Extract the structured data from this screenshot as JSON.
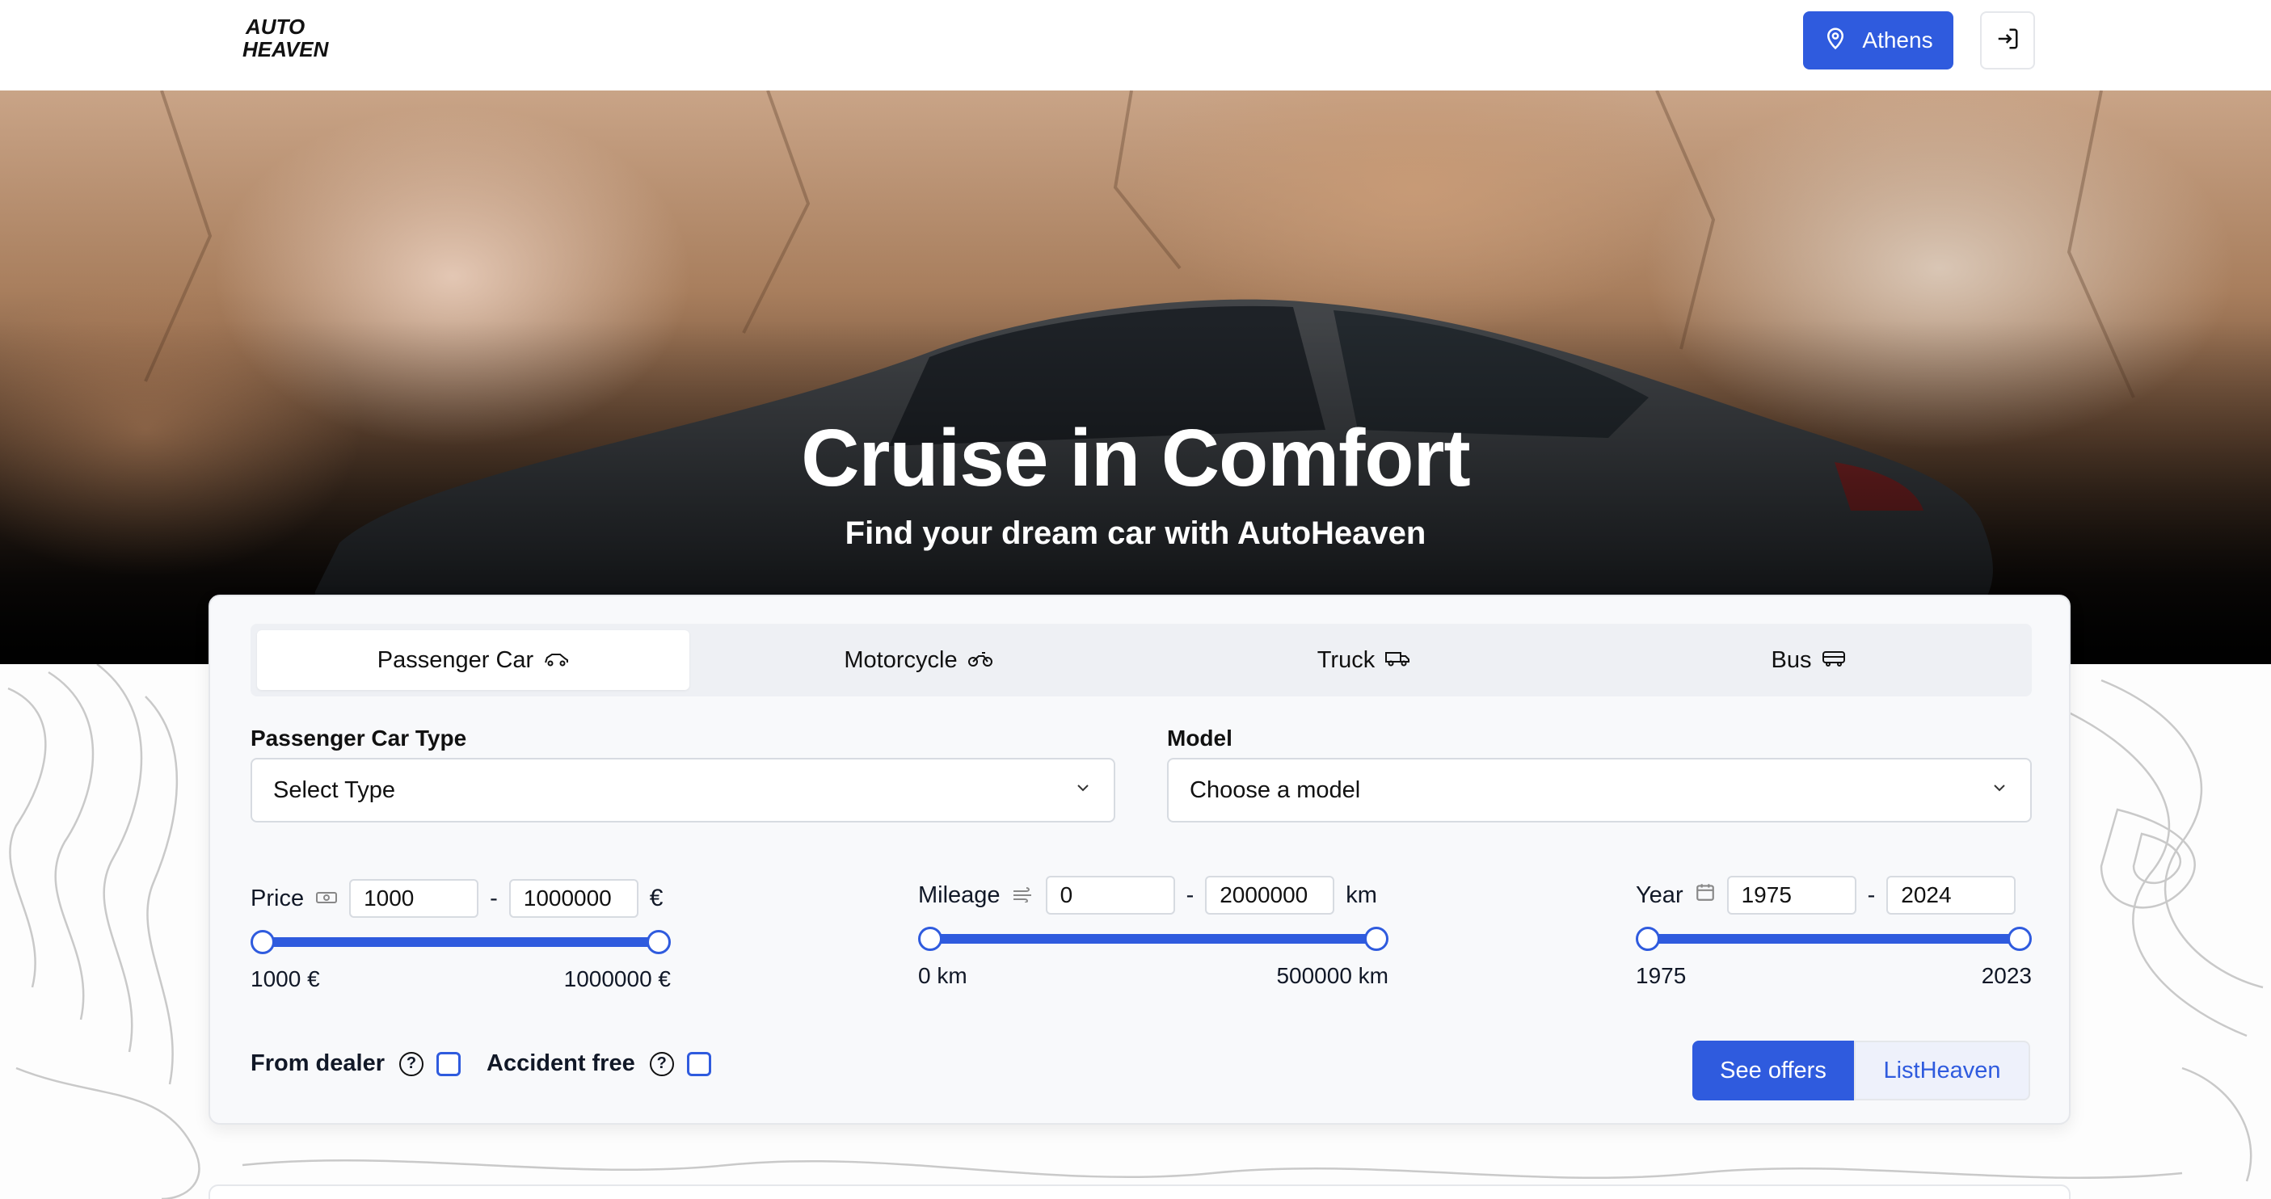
{
  "header": {
    "logo_line1": "AUTO",
    "logo_line2": "HEAVEN",
    "location_label": "Athens",
    "location_icon": "map-pin-icon",
    "login_icon": "login-icon"
  },
  "hero": {
    "title": "Cruise in Comfort",
    "subtitle": "Find your dream car with AutoHeaven"
  },
  "tabs": [
    {
      "label": "Passenger Car",
      "icon": "car-icon",
      "active": true
    },
    {
      "label": "Motorcycle",
      "icon": "motorcycle-icon",
      "active": false
    },
    {
      "label": "Truck",
      "icon": "truck-icon",
      "active": false
    },
    {
      "label": "Bus",
      "icon": "bus-icon",
      "active": false
    }
  ],
  "filters": {
    "type_label": "Passenger Car Type",
    "type_value": "Select Type",
    "model_label": "Model",
    "model_value": "Choose a model",
    "price": {
      "label": "Price",
      "min_input": "1000",
      "max_input": "1000000",
      "separator": "-",
      "unit": "€",
      "min_caption": "1000 €",
      "max_caption": "1000000 €",
      "low_fraction": 0.0,
      "high_fraction": 1.0
    },
    "mileage": {
      "label": "Mileage",
      "min_input": "0",
      "max_input": "2000000",
      "separator": "-",
      "unit": "km",
      "min_caption": "0 km",
      "max_caption": "500000 km",
      "low_fraction": 0.0,
      "high_fraction": 1.0
    },
    "year": {
      "label": "Year",
      "min_input": "1975",
      "max_input": "2024",
      "separator": "-",
      "min_caption": "1975",
      "max_caption": "2023",
      "low_fraction": 0.0,
      "high_fraction": 1.0
    },
    "from_dealer_label": "From dealer",
    "accident_free_label": "Accident free",
    "help_glyph": "?"
  },
  "actions": {
    "see_offers": "See offers",
    "list_heaven": "ListHeaven"
  },
  "colors": {
    "accent": "#2f5bde"
  }
}
